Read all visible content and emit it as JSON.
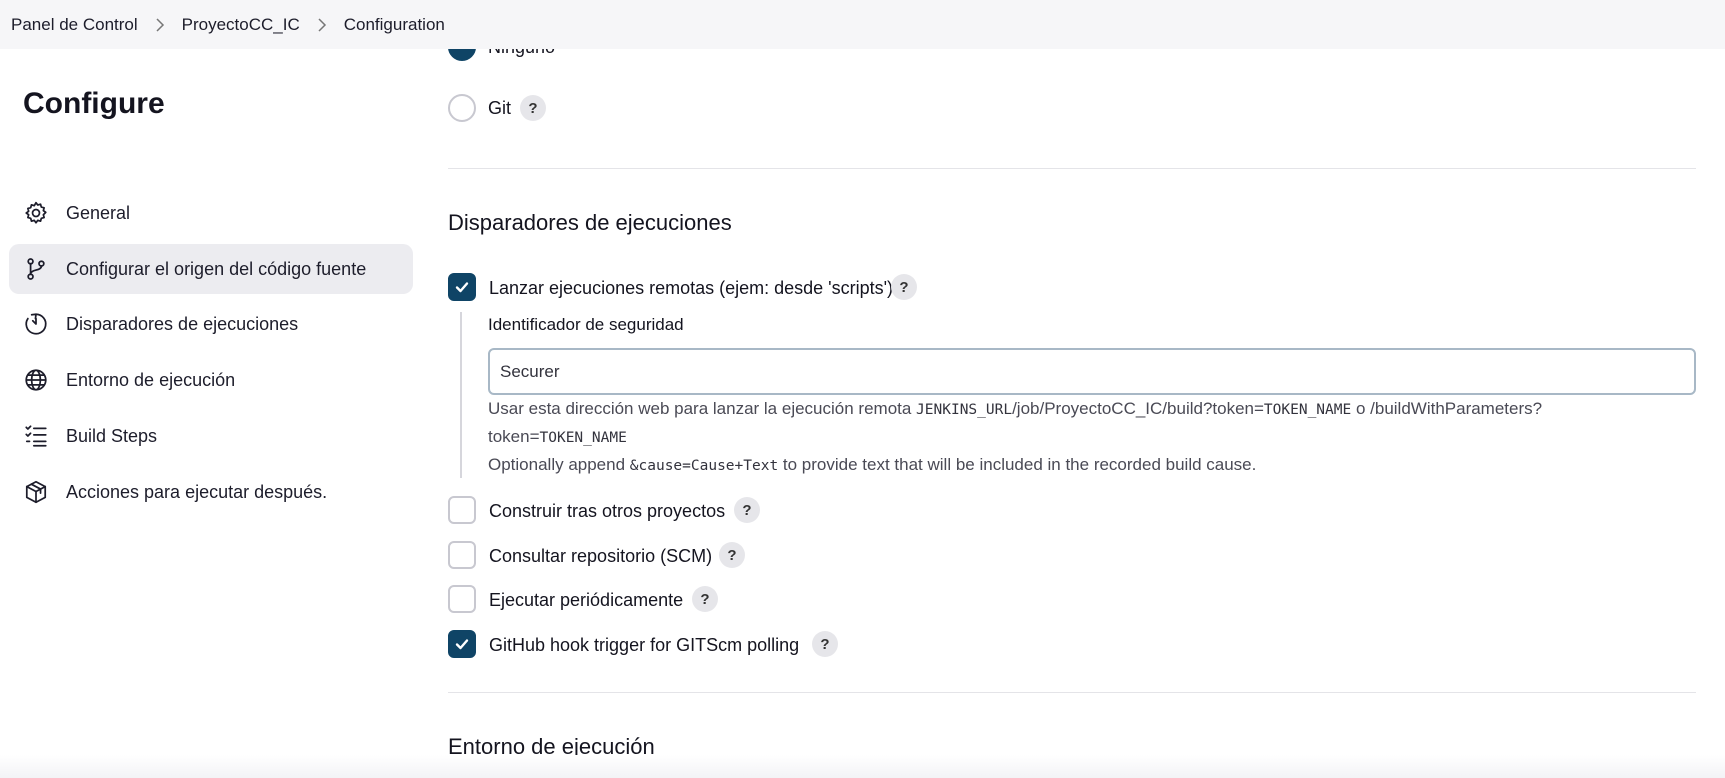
{
  "breadcrumb": {
    "items": [
      "Panel de Control",
      "ProyectoCC_IC",
      "Configuration"
    ]
  },
  "sidebar": {
    "title": "Configure",
    "items": [
      {
        "label": "General",
        "icon": "gear-icon"
      },
      {
        "label": "Configurar el origen del código fuente",
        "icon": "branch-icon"
      },
      {
        "label": "Disparadores de ejecuciones",
        "icon": "clock-icon"
      },
      {
        "label": "Entorno de ejecución",
        "icon": "globe-icon"
      },
      {
        "label": "Build Steps",
        "icon": "list-icon"
      },
      {
        "label": "Acciones para ejecutar después.",
        "icon": "package-icon"
      }
    ],
    "active_index": 1
  },
  "scm": {
    "options": [
      {
        "label": "Ninguno",
        "checked": true
      },
      {
        "label": "Git",
        "checked": false
      }
    ]
  },
  "triggers": {
    "title": "Disparadores de ejecuciones",
    "remote": {
      "label": "Lanzar ejecuciones remotas (ejem: desde 'scripts')",
      "checked": true,
      "token_label": "Identificador de seguridad",
      "token_value": "Securer",
      "help": {
        "line1_pre": "Usar esta dirección web para lanzar la ejecución remota ",
        "line1_code1": "JENKINS_URL",
        "line1_mid": "/job/ProyectoCC_IC/build?token=",
        "line1_code2": "TOKEN_NAME",
        "line1_post": " o /buildWithParameters?",
        "line2_pre": "token=",
        "line2_code": "TOKEN_NAME",
        "line3_pre": "Optionally append ",
        "line3_code": "&cause=Cause+Text",
        "line3_post": " to provide text that will be included in the recorded build cause."
      }
    },
    "others": [
      {
        "label": "Construir tras otros proyectos",
        "checked": false
      },
      {
        "label": "Consultar repositorio (SCM)",
        "checked": false
      },
      {
        "label": "Ejecutar periódicamente",
        "checked": false
      },
      {
        "label": "GitHub hook trigger for GITScm polling",
        "checked": true
      }
    ]
  },
  "env": {
    "title": "Entorno de ejecución"
  },
  "help_symbol": "?",
  "colors": {
    "accent": "#0f4466",
    "breadcrumb_bg": "#f6f6f8",
    "active_item_bg": "#ececf0"
  }
}
